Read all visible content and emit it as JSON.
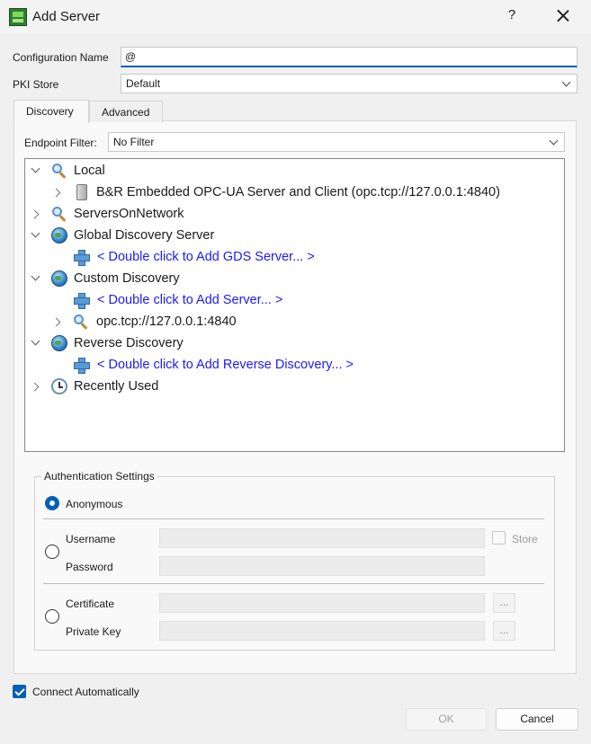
{
  "window": {
    "title": "Add Server",
    "help": "?"
  },
  "config": {
    "name_label": "Configuration Name",
    "name_value": "@",
    "pki_label": "PKI Store",
    "pki_value": "Default"
  },
  "tabs": [
    {
      "label": "Discovery",
      "active": true
    },
    {
      "label": "Advanced",
      "active": false
    }
  ],
  "endpoint_filter": {
    "label": "Endpoint Filter:",
    "value": "No Filter"
  },
  "tree": [
    {
      "label": "Local",
      "icon": "magnifier-icon",
      "expander": "expanded"
    },
    {
      "label": "B&R Embedded OPC-UA Server and Client (opc.tcp://127.0.0.1:4840)",
      "icon": "server-icon",
      "expander": "collapsed"
    },
    {
      "label": "ServersOnNetwork",
      "icon": "magnifier-icon",
      "expander": "collapsed"
    },
    {
      "label": "Global Discovery Server",
      "icon": "globe-icon",
      "expander": "expanded"
    },
    {
      "label": "< Double click to Add GDS Server... >",
      "icon": "plus-icon",
      "expander": "none"
    },
    {
      "label": "Custom Discovery",
      "icon": "globe-icon",
      "expander": "expanded"
    },
    {
      "label": "< Double click to Add Server... >",
      "icon": "plus-icon",
      "expander": "none"
    },
    {
      "label": "opc.tcp://127.0.0.1:4840",
      "icon": "magnifier-icon",
      "expander": "collapsed"
    },
    {
      "label": "Reverse Discovery",
      "icon": "globe-icon",
      "expander": "expanded"
    },
    {
      "label": "< Double click to Add Reverse Discovery... >",
      "icon": "plus-icon",
      "expander": "none"
    },
    {
      "label": "Recently Used",
      "icon": "clock-icon",
      "expander": "collapsed"
    }
  ],
  "auth": {
    "title": "Authentication Settings",
    "anonymous": "Anonymous",
    "username": "Username",
    "password": "Password",
    "store": "Store",
    "certificate": "Certificate",
    "private_key": "Private Key",
    "browse": "...",
    "selected": "Anonymous"
  },
  "connect_auto": {
    "label": "Connect Automatically",
    "checked": true
  },
  "buttons": {
    "ok": "OK",
    "cancel": "Cancel"
  },
  "colors": {
    "accent": "#005fb8",
    "link": "#1a1aff"
  }
}
